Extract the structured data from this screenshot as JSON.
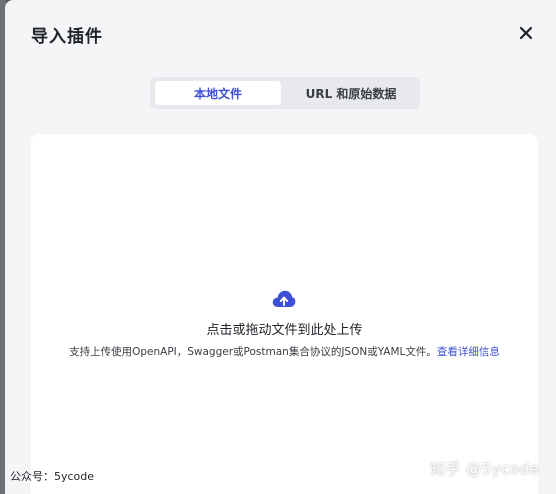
{
  "modal": {
    "title": "导入插件",
    "close_icon": "close-icon"
  },
  "tabs": [
    {
      "label": "本地文件",
      "active": true
    },
    {
      "label": "URL 和原始数据",
      "active": false
    }
  ],
  "dropzone": {
    "icon": "cloud-upload-icon",
    "main_text": "点击或拖动文件到此处上传",
    "sub_text": "支持上传使用OpenAPI，Swagger或Postman集合协议的JSON或YAML文件。",
    "link_text": "查看详细信息"
  },
  "watermarks": {
    "left": "公众号：5ycode",
    "right": "知乎 @5ycode"
  },
  "colors": {
    "accent": "#3d50d7",
    "modal_bg": "#f4f5f7",
    "backdrop": "#565a5f"
  }
}
